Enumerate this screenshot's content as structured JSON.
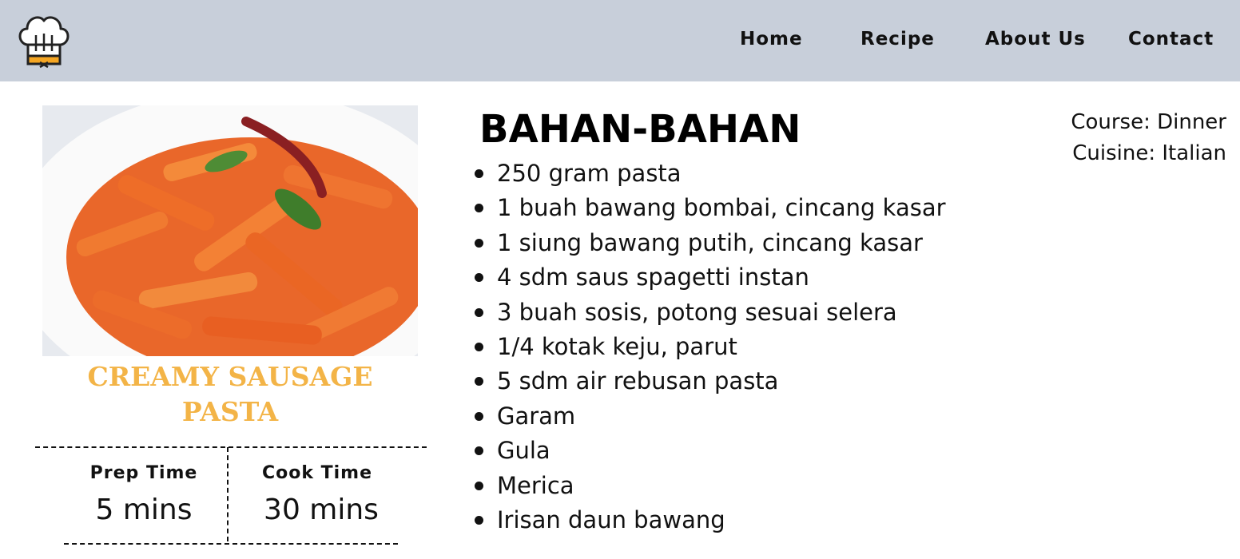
{
  "nav": {
    "logo": "chef-hat-logo",
    "items": [
      "Home",
      "Recipe",
      "About Us",
      "Contact"
    ]
  },
  "recipe": {
    "image": "penne-pasta-with-sauce-and-chili",
    "title": "CREAMY SAUSAGE PASTA",
    "prep_time": {
      "label": "Prep Time",
      "value": "5 mins"
    },
    "cook_time": {
      "label": "Cook Time",
      "value": "30 mins"
    }
  },
  "ingredients": {
    "heading": "BAHAN-BAHAN",
    "items": [
      "250 gram pasta",
      "1 buah bawang bombai, cincang kasar",
      "1 siung bawang putih, cincang kasar",
      "4 sdm saus spagetti instan",
      "3 buah sosis, potong sesuai selera",
      "1/4 kotak keju, parut",
      "5 sdm air rebusan pasta",
      "Garam",
      "Gula",
      "Merica",
      "Irisan daun bawang"
    ]
  },
  "meta": {
    "course": "Course: Dinner",
    "cuisine": "Cuisine: Italian"
  },
  "colors": {
    "navbar": "#c8cfda",
    "title": "#f3b447",
    "logo_accent": "#f5a623"
  }
}
